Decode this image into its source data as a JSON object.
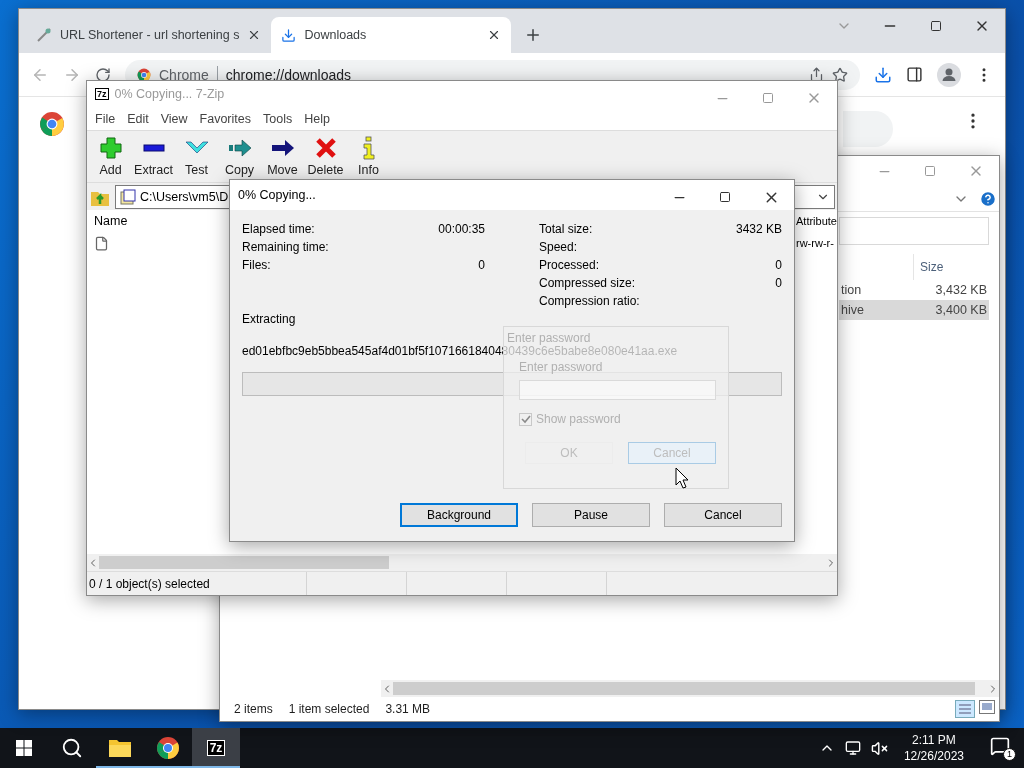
{
  "browser": {
    "tabs": [
      {
        "title": "URL Shortener - url shortening s",
        "selected": false
      },
      {
        "title": "Downloads",
        "selected": true
      }
    ],
    "address": {
      "site_label": "Chrome",
      "url": "chrome://downloads"
    }
  },
  "explorer": {
    "columns": {
      "size": "Size"
    },
    "rows": [
      {
        "name": "tion",
        "size": "3,432 KB",
        "selected": false
      },
      {
        "name": "hive",
        "size": "3,400 KB",
        "selected": true
      }
    ],
    "status": {
      "count": "2 items",
      "selection": "1 item selected",
      "size": "3.31 MB"
    }
  },
  "sevenzip": {
    "logo": "7z",
    "title": "0% Copying... 7-Zip",
    "menu": [
      "File",
      "Edit",
      "View",
      "Favorites",
      "Tools",
      "Help"
    ],
    "toolbar": [
      {
        "kind": "add",
        "label": "Add"
      },
      {
        "kind": "extract",
        "label": "Extract"
      },
      {
        "kind": "test",
        "label": "Test"
      },
      {
        "kind": "copy",
        "label": "Copy"
      },
      {
        "kind": "move",
        "label": "Move"
      },
      {
        "kind": "delete",
        "label": "Delete"
      },
      {
        "kind": "info",
        "label": "Info"
      }
    ],
    "path": "C:\\Users\\vm5\\D",
    "columns": {
      "name": "Name",
      "attribute": "Attribute"
    },
    "rows": [
      {
        "attribute": "rw-rw-r-"
      }
    ],
    "status": "0 / 1 object(s) selected"
  },
  "progress_dialog": {
    "title": "0% Copying...",
    "left_stats": [
      {
        "label": "Elapsed time:",
        "value": "00:00:35"
      },
      {
        "label": "Remaining time:"
      },
      {
        "label": "Files:",
        "value": "0"
      }
    ],
    "right_stats": [
      {
        "label": "Total size:",
        "value": "3432 KB"
      },
      {
        "label": "Speed:"
      },
      {
        "label": "Processed:",
        "value": "0"
      },
      {
        "label": "Compressed size:",
        "value": "0"
      },
      {
        "label": "Compression ratio:"
      }
    ],
    "operation": "Extracting",
    "file": "ed01ebfbc9eb5bbea545af4d01bf5f1071661840480439c6e5babe8e080e41aa.exe",
    "level": 0,
    "buttons": [
      {
        "label": "Background",
        "focused": true
      },
      {
        "label": "Pause",
        "focused": false
      },
      {
        "label": "Cancel",
        "focused": false
      }
    ]
  },
  "password_dialog": {
    "title": "Enter password",
    "label": "Enter password",
    "show_password": {
      "label": "Show password",
      "checked": true
    },
    "buttons": [
      {
        "label": "OK",
        "hovered": false
      },
      {
        "label": "Cancel",
        "hovered": true
      }
    ]
  },
  "taskbar": {
    "apps": [
      {
        "kind": "explorer",
        "active": false
      },
      {
        "kind": "chrome",
        "active": false
      },
      {
        "kind": "sevenzip",
        "label": "7z",
        "active": true
      }
    ],
    "time": "2:11 PM",
    "date": "12/26/2023",
    "notifications": "1"
  }
}
